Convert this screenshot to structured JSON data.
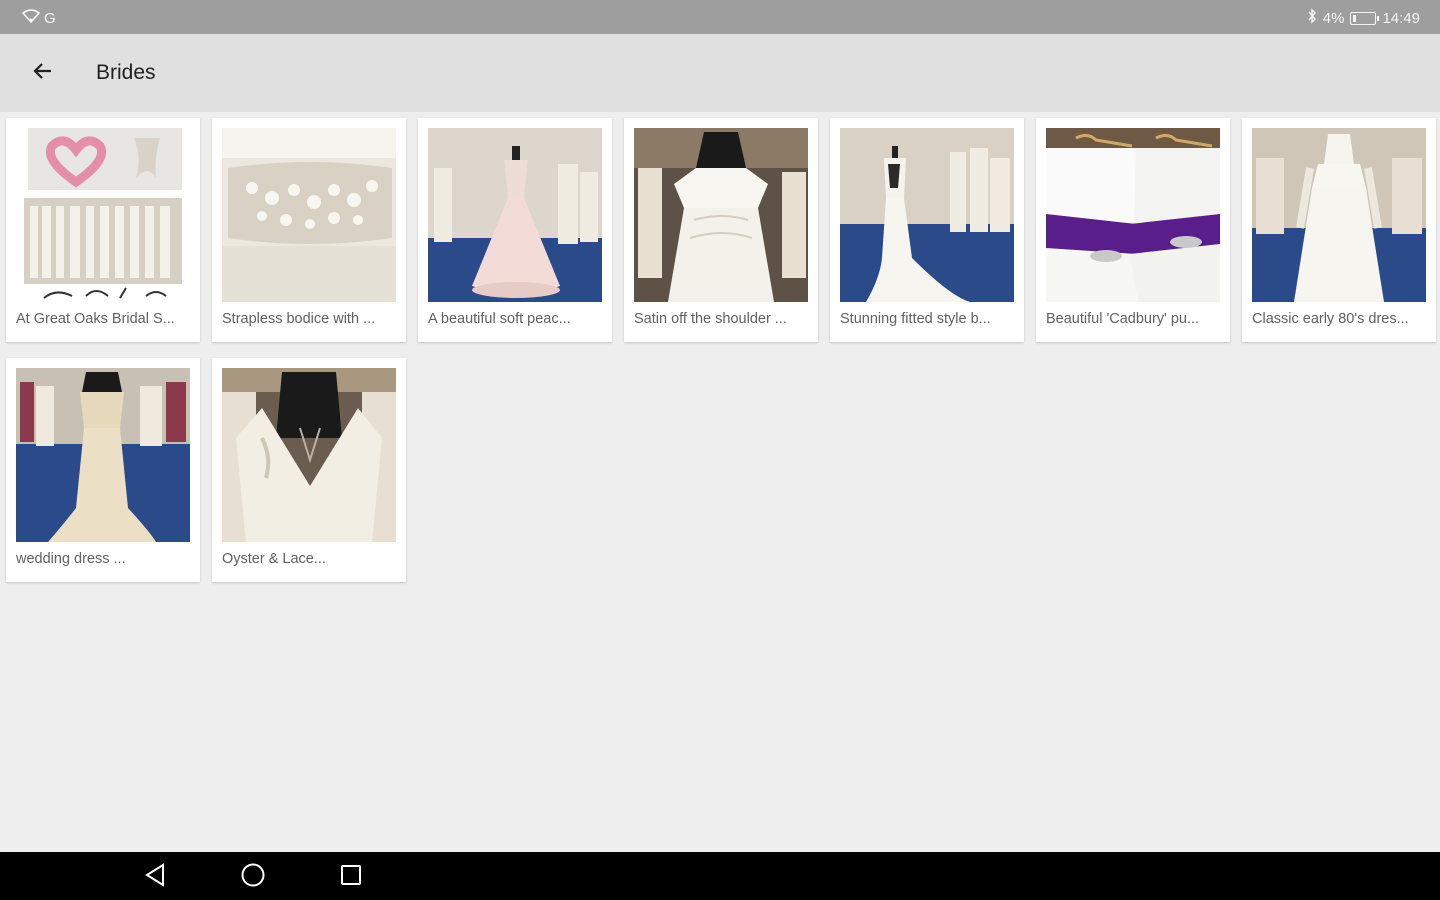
{
  "status_bar": {
    "network": "G",
    "battery_percent": "4%",
    "time": "14:49",
    "icons": [
      "wifi-icon",
      "bluetooth-icon",
      "battery-icon"
    ]
  },
  "app_bar": {
    "title": "Brides",
    "back_icon": "arrow-back-icon"
  },
  "gallery": {
    "items": [
      {
        "caption": "At Great Oaks Bridal S..."
      },
      {
        "caption": "Strapless bodice with ..."
      },
      {
        "caption": "A beautiful soft peac..."
      },
      {
        "caption": "Satin off the shoulder ..."
      },
      {
        "caption": "Stunning fitted style b..."
      },
      {
        "caption": "Beautiful 'Cadbury' pu..."
      },
      {
        "caption": "Classic early 80's dres..."
      },
      {
        "caption": "wedding dress ..."
      },
      {
        "caption": "Oyster & Lace..."
      }
    ]
  },
  "nav_bar": {
    "icons": [
      "back-triangle-icon",
      "home-circle-icon",
      "recents-square-icon"
    ]
  },
  "colors": {
    "status_bar": "#9e9e9e",
    "app_bar": "#e0e0e0",
    "background": "#eeeeee",
    "carpet_blue": "#2b4a8a",
    "purple_sash": "#5a1e8c"
  }
}
